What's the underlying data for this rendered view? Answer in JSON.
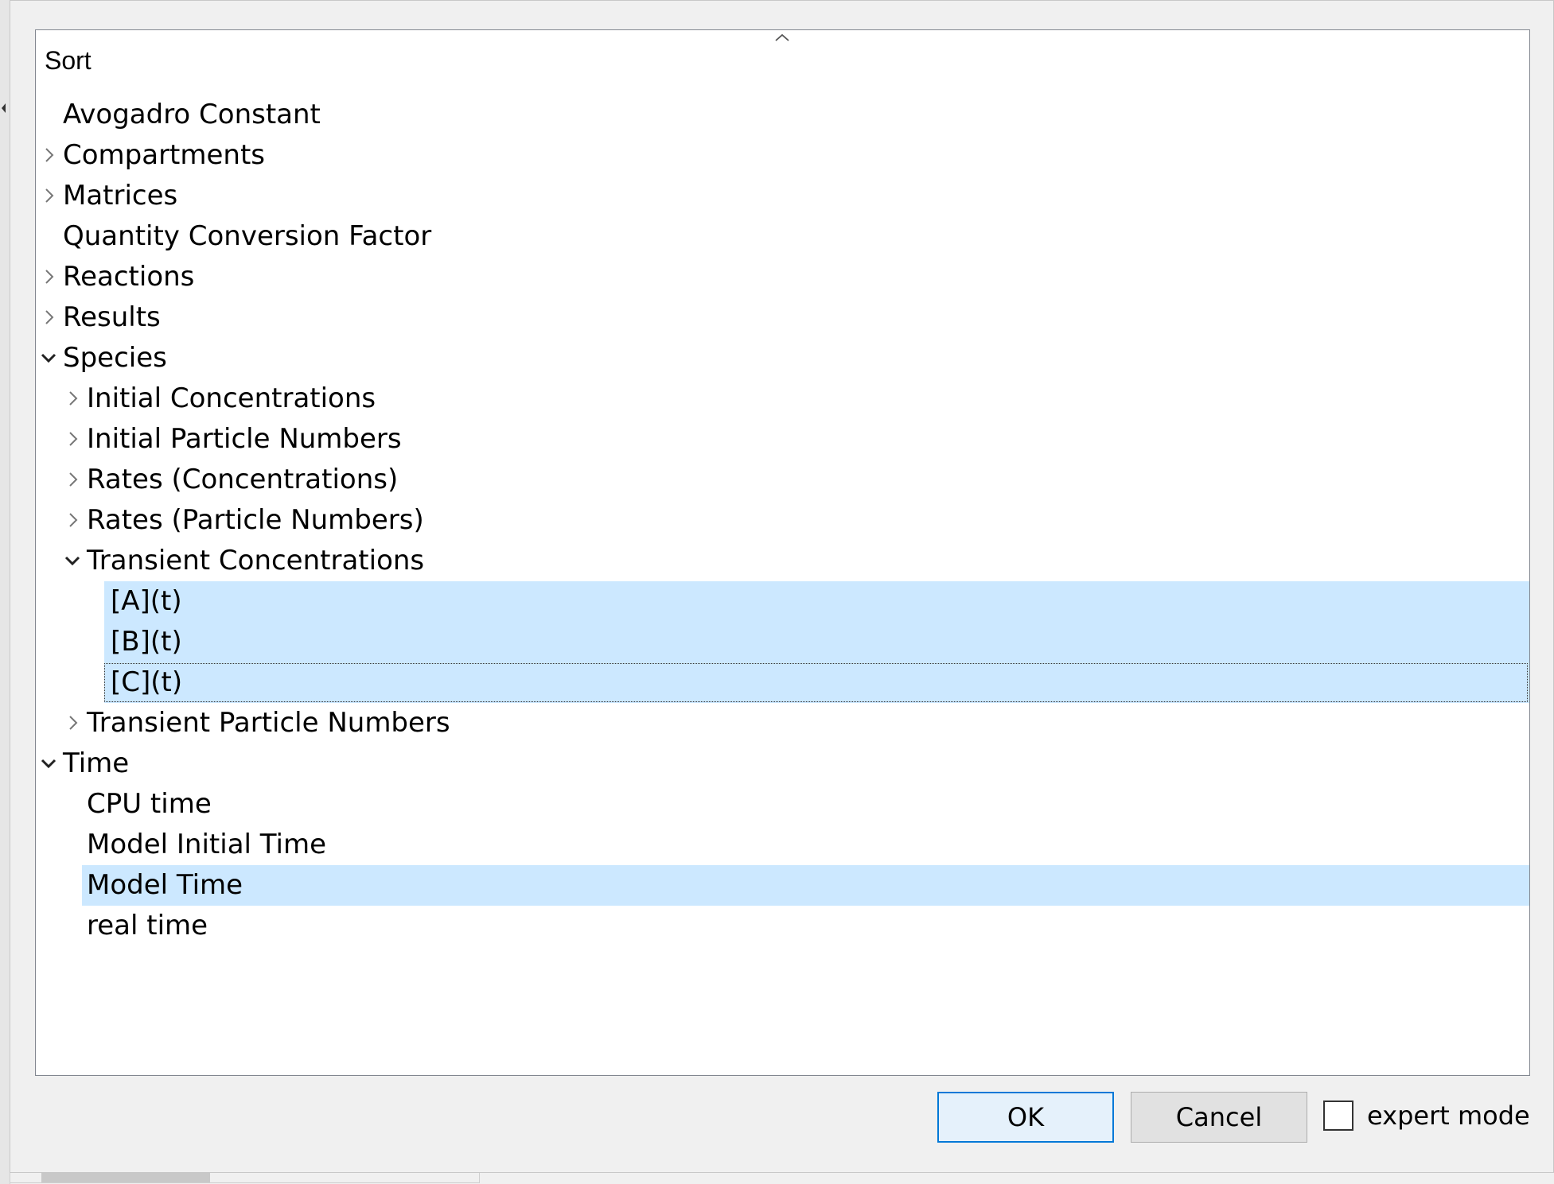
{
  "header": {
    "sort_label": "Sort"
  },
  "tree": {
    "items": [
      {
        "label": "Avogadro Constant",
        "level": 0,
        "expander": "none",
        "selected": false,
        "focused": false
      },
      {
        "label": "Compartments",
        "level": 0,
        "expander": "collapsed",
        "selected": false,
        "focused": false
      },
      {
        "label": "Matrices",
        "level": 0,
        "expander": "collapsed",
        "selected": false,
        "focused": false
      },
      {
        "label": "Quantity Conversion Factor",
        "level": 0,
        "expander": "none",
        "selected": false,
        "focused": false
      },
      {
        "label": "Reactions",
        "level": 0,
        "expander": "collapsed",
        "selected": false,
        "focused": false
      },
      {
        "label": "Results",
        "level": 0,
        "expander": "collapsed",
        "selected": false,
        "focused": false
      },
      {
        "label": "Species",
        "level": 0,
        "expander": "expanded",
        "selected": false,
        "focused": false
      },
      {
        "label": "Initial Concentrations",
        "level": 1,
        "expander": "collapsed",
        "selected": false,
        "focused": false
      },
      {
        "label": "Initial Particle Numbers",
        "level": 1,
        "expander": "collapsed",
        "selected": false,
        "focused": false
      },
      {
        "label": "Rates (Concentrations)",
        "level": 1,
        "expander": "collapsed",
        "selected": false,
        "focused": false
      },
      {
        "label": "Rates (Particle Numbers)",
        "level": 1,
        "expander": "collapsed",
        "selected": false,
        "focused": false
      },
      {
        "label": "Transient Concentrations",
        "level": 1,
        "expander": "expanded",
        "selected": false,
        "focused": false
      },
      {
        "label": "[A](t)",
        "level": 2,
        "expander": "none",
        "selected": true,
        "focused": false
      },
      {
        "label": "[B](t)",
        "level": 2,
        "expander": "none",
        "selected": true,
        "focused": false
      },
      {
        "label": "[C](t)",
        "level": 2,
        "expander": "none",
        "selected": true,
        "focused": true
      },
      {
        "label": "Transient Particle Numbers",
        "level": 1,
        "expander": "collapsed",
        "selected": false,
        "focused": false
      },
      {
        "label": "Time",
        "level": 0,
        "expander": "expanded",
        "selected": false,
        "focused": false
      },
      {
        "label": "CPU time",
        "level": 1,
        "expander": "none",
        "selected": false,
        "focused": false
      },
      {
        "label": "Model Initial Time",
        "level": 1,
        "expander": "none",
        "selected": false,
        "focused": false
      },
      {
        "label": "Model Time",
        "level": 1,
        "expander": "none",
        "selected": true,
        "focused": false
      },
      {
        "label": "real time",
        "level": 1,
        "expander": "none",
        "selected": false,
        "focused": false
      }
    ]
  },
  "buttons": {
    "ok_label": "OK",
    "cancel_label": "Cancel"
  },
  "expert_mode": {
    "label": "expert mode",
    "checked": false
  },
  "colors": {
    "selection": "#cce8ff",
    "ok_border": "#0078d7",
    "panel_border": "#828790"
  },
  "icons": {
    "collapsed": "chevron-right-icon",
    "expanded": "chevron-down-icon",
    "sort": "sort-caret-up-icon"
  }
}
